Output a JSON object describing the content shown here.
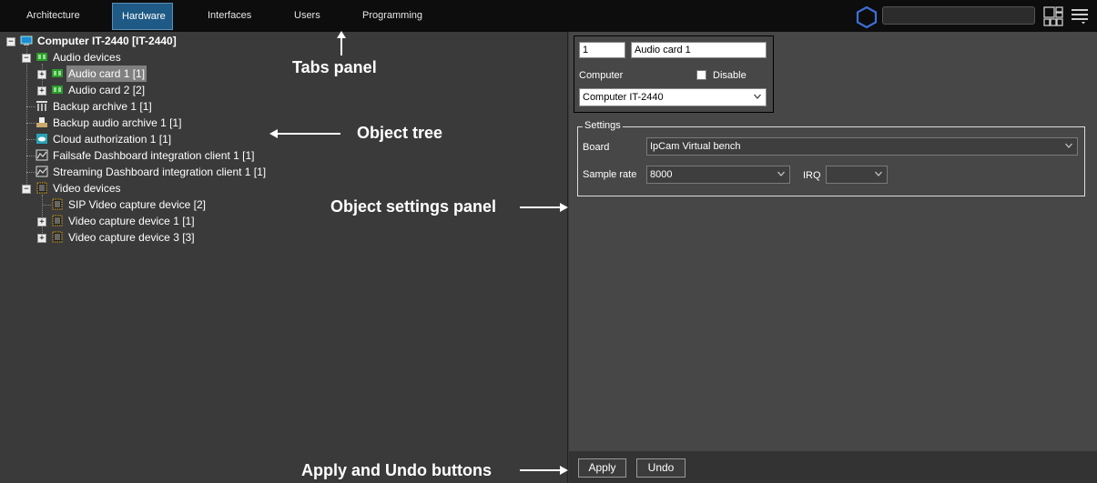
{
  "tabs": [
    {
      "label": "Architecture",
      "active": false
    },
    {
      "label": "Hardware",
      "active": true
    },
    {
      "label": "Interfaces",
      "active": false
    },
    {
      "label": "Users",
      "active": false
    },
    {
      "label": "Programming",
      "active": false
    }
  ],
  "header": {
    "search_value": "",
    "icons": [
      "hexagon-logo-icon",
      "layout-grid-icon",
      "menu-icon"
    ]
  },
  "tree": {
    "root": "Computer IT-2440 [IT-2440]",
    "items": [
      {
        "label": "Audio devices",
        "icon": "audio-devices-icon"
      },
      {
        "label": "Audio card 1 [1]",
        "icon": "audio-card-icon",
        "selected": true
      },
      {
        "label": "Audio card 2 [2]",
        "icon": "audio-card-icon"
      },
      {
        "label": "Backup archive 1 [1]",
        "icon": "backup-archive-icon"
      },
      {
        "label": "Backup audio archive 1 [1]",
        "icon": "backup-audio-archive-icon"
      },
      {
        "label": "Cloud authorization 1 [1]",
        "icon": "cloud-authorization-icon"
      },
      {
        "label": "Failsafe Dashboard integration client 1 [1]",
        "icon": "dashboard-integration-icon"
      },
      {
        "label": "Streaming Dashboard integration client 1 [1]",
        "icon": "dashboard-integration-icon"
      },
      {
        "label": "Video devices",
        "icon": "video-devices-icon"
      },
      {
        "label": "SIP Video capture device [2]",
        "icon": "video-capture-icon"
      },
      {
        "label": "Video capture device 1 [1]",
        "icon": "video-capture-icon"
      },
      {
        "label": "Video capture device 3 [3]",
        "icon": "video-capture-icon"
      }
    ]
  },
  "object": {
    "id": "1",
    "name": "Audio card 1",
    "computer_label": "Computer",
    "disable_label": "Disable",
    "disable_checked": false,
    "computer_value": "Computer IT-2440"
  },
  "settings": {
    "title": "Settings",
    "board_label": "Board",
    "board_value": "IpCam Virtual bench",
    "sample_rate_label": "Sample rate",
    "sample_rate_value": "8000",
    "irq_label": "IRQ",
    "irq_value": ""
  },
  "buttons": {
    "apply": "Apply",
    "undo": "Undo"
  },
  "annotations": {
    "tabs_panel": "Tabs panel",
    "object_tree": "Object tree",
    "object_settings_panel": "Object settings panel",
    "apply_undo": "Apply and Undo buttons"
  },
  "colors": {
    "topbar": "#0d0d0d",
    "active_tab": "#1e5a85",
    "tree_bg": "#3a3a3a",
    "settings_bg": "#474747",
    "logo": "#3e6fd8"
  }
}
